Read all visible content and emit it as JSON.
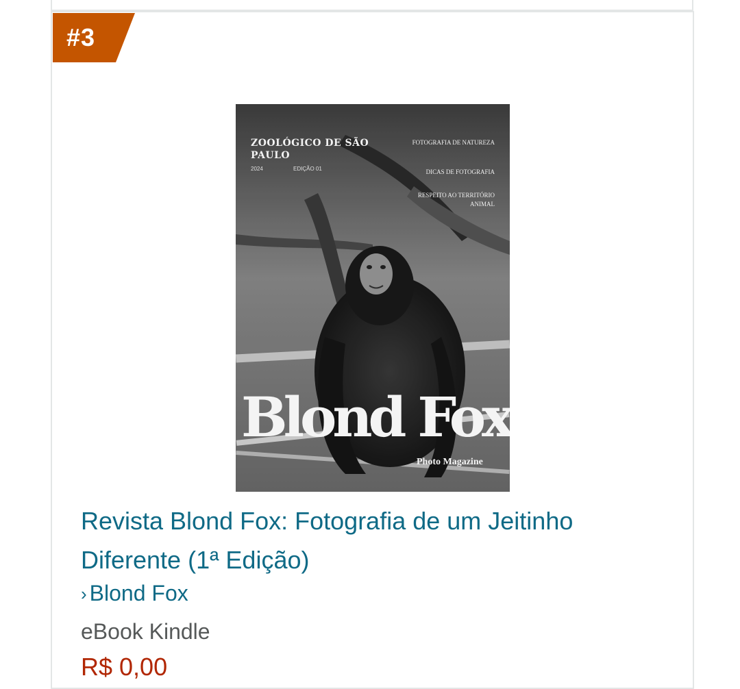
{
  "rank": "#3",
  "colors": {
    "badge": "#c45500",
    "link": "#0f6a86",
    "price": "#b12704",
    "muted": "#565959"
  },
  "cover": {
    "header_left": "ZOOLÓGICO DE SÃO PAULO",
    "year": "2024",
    "edition": "EDIÇÃO 01",
    "right_1": "FOTOGRAFIA DE NATUREZA",
    "right_2": "DICAS DE FOTOGRAFIA",
    "right_3": "RESPEITO AO TERRITÓRIO ANIMAL",
    "brand": "Blond Fox.",
    "subtitle": "Photo Magazine"
  },
  "product": {
    "title": "Revista Blond Fox: Fotografia de um Jeitinho Diferente (1ª Edição)",
    "author": "Blond Fox",
    "author_icon": "chevron-right-icon",
    "format": "eBook Kindle",
    "price": "R$ 0,00"
  }
}
